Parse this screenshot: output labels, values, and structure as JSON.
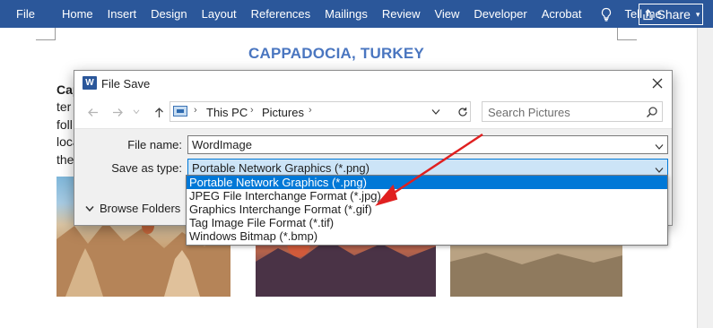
{
  "ribbon": {
    "tabs": [
      "File",
      "Home",
      "Insert",
      "Design",
      "Layout",
      "References",
      "Mailings",
      "Review",
      "View",
      "Developer",
      "Acrobat"
    ],
    "tell_me": "Tell me",
    "share": "Share",
    "color": "#2b579a"
  },
  "document": {
    "title": "CAPPADOCIA, TURKEY",
    "title_color": "#4a76c0",
    "lines": [
      "Cap",
      "ter",
      "foll",
      "loca",
      "the"
    ]
  },
  "dialog": {
    "title": "File Save",
    "app_icon": "W",
    "address": {
      "icon": "this-pc-icon",
      "segments": [
        "This PC",
        "Pictures"
      ]
    },
    "search_placeholder": "Search Pictures",
    "file_name_label": "File name:",
    "file_name_value": "WordImage",
    "save_type_label": "Save as type:",
    "save_type_value": "Portable Network Graphics (*.png)",
    "browse_folders": "Browse Folders",
    "file_types": [
      "Portable Network Graphics (*.png)",
      "JPEG File Interchange Format (*.jpg)",
      "Graphics Interchange Format (*.gif)",
      "Tag Image File Format (*.tif)",
      "Windows Bitmap (*.bmp)"
    ],
    "selected_type_index": 0,
    "highlight_color": "#0078d7"
  },
  "annotation": {
    "arrow_color": "#e02020"
  }
}
